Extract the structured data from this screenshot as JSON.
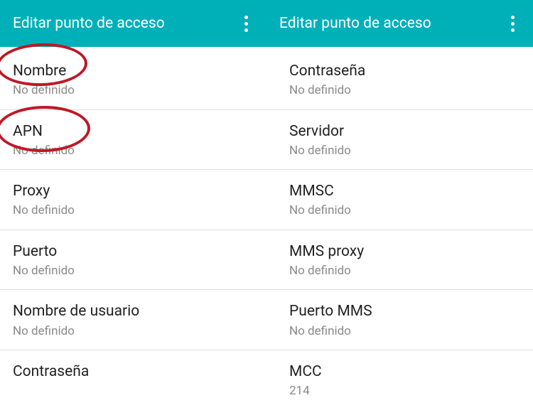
{
  "screen1": {
    "header": {
      "title": "Editar punto de acceso"
    },
    "items": [
      {
        "label": "Nombre",
        "value": "No definido"
      },
      {
        "label": "APN",
        "value": "No definido"
      },
      {
        "label": "Proxy",
        "value": "No definido"
      },
      {
        "label": "Puerto",
        "value": "No definido"
      },
      {
        "label": "Nombre de usuario",
        "value": "No definido"
      },
      {
        "label": "Contraseña",
        "value": ""
      }
    ]
  },
  "screen2": {
    "header": {
      "title": "Editar punto de acceso"
    },
    "items": [
      {
        "label": "Contraseña",
        "value": "No definido"
      },
      {
        "label": "Servidor",
        "value": "No definido"
      },
      {
        "label": "MMSC",
        "value": "No definido"
      },
      {
        "label": "MMS proxy",
        "value": "No definido"
      },
      {
        "label": "Puerto MMS",
        "value": "No definido"
      },
      {
        "label": "MCC",
        "value": "214"
      }
    ]
  }
}
